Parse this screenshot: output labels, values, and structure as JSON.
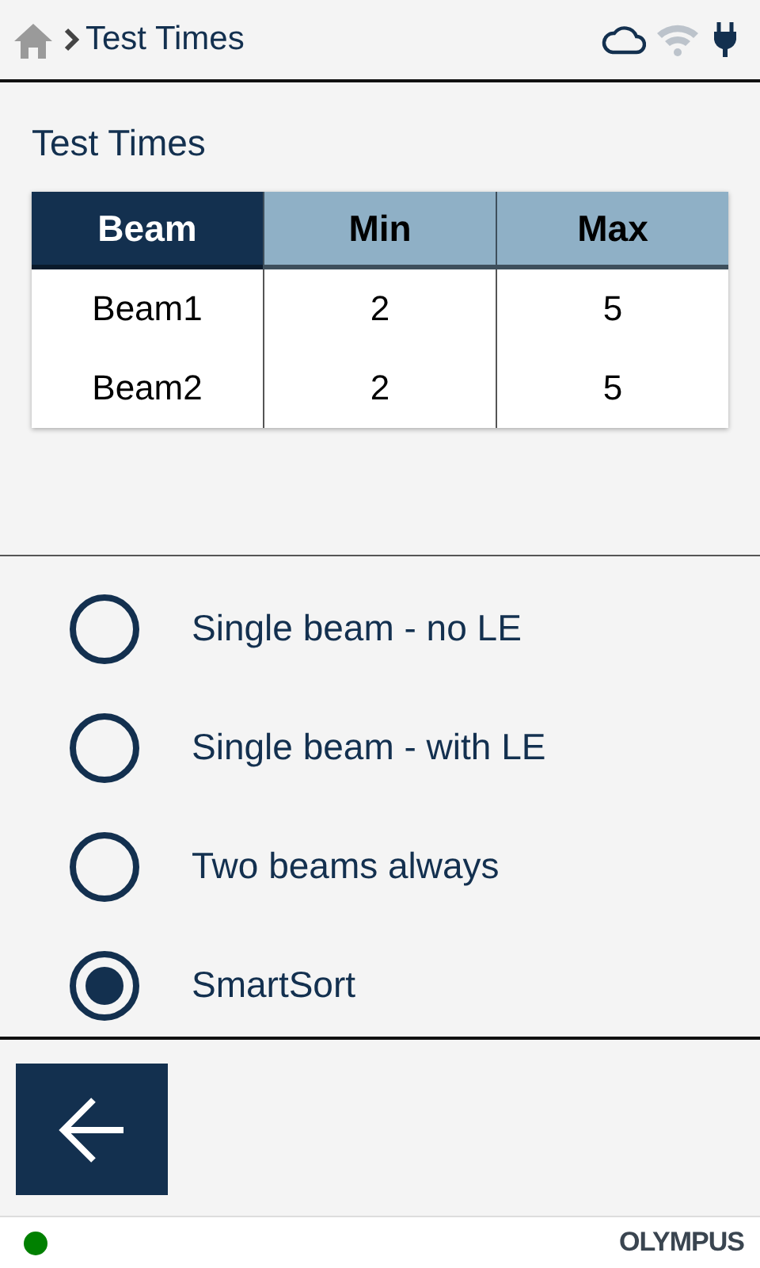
{
  "breadcrumb": {
    "title": "Test Times"
  },
  "status_icons": {
    "wifi_connected": false
  },
  "section_title": "Test Times",
  "table": {
    "columns": [
      {
        "label": "Beam",
        "selected": true
      },
      {
        "label": "Min",
        "selected": false
      },
      {
        "label": "Max",
        "selected": false
      }
    ],
    "rows": [
      [
        "Beam1",
        "2",
        "5"
      ],
      [
        "Beam2",
        "2",
        "5"
      ]
    ]
  },
  "options": [
    {
      "label": "Single beam - no LE",
      "selected": false
    },
    {
      "label": "Single beam - with LE",
      "selected": false
    },
    {
      "label": "Two beams always",
      "selected": false
    },
    {
      "label": "SmartSort",
      "selected": true
    }
  ],
  "footer": {
    "status": {
      "color": "#008000"
    },
    "brand": "OLYMPUS"
  }
}
